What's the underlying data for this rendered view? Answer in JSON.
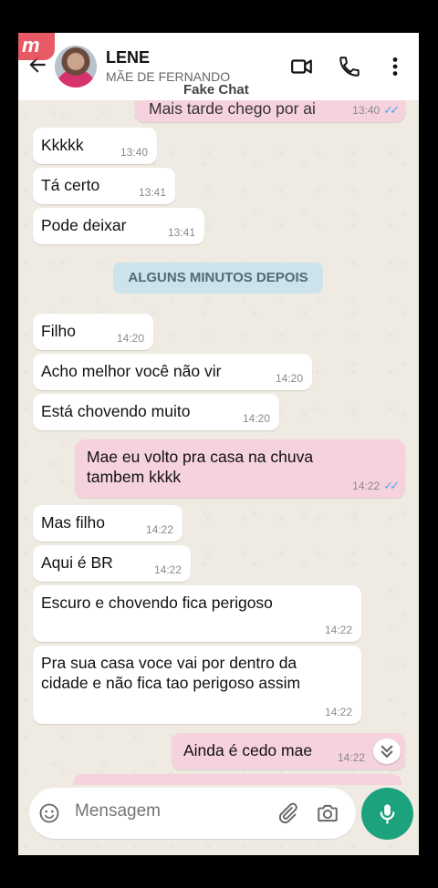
{
  "header": {
    "contact_name": "LENE",
    "contact_subtitle": "MÃE DE FERNANDO",
    "watermark": "Fake Chat",
    "logo_text": "m"
  },
  "messages": [
    {
      "dir": "out",
      "text": "Mais tarde chego por ai",
      "time": "13:40",
      "read": true
    },
    {
      "dir": "in",
      "text": "Kkkkk",
      "time": "13:40"
    },
    {
      "dir": "in",
      "text": "Tá certo",
      "time": "13:41"
    },
    {
      "dir": "in",
      "text": "Pode deixar",
      "time": "13:41"
    },
    {
      "dir": "in",
      "text": "Filho",
      "time": "14:20"
    },
    {
      "dir": "in",
      "text": "Acho melhor você não vir",
      "time": "14:20"
    },
    {
      "dir": "in",
      "text": "Está chovendo muito",
      "time": "14:20"
    },
    {
      "dir": "out",
      "text": "Mae eu volto pra casa na chuva tambem kkkk",
      "time": "14:22",
      "read": true
    },
    {
      "dir": "in",
      "text": "Mas filho",
      "time": "14:22"
    },
    {
      "dir": "in",
      "text": "Aqui é BR",
      "time": "14:22"
    },
    {
      "dir": "in",
      "text": "Escuro e chovendo fica perigoso",
      "time": "14:22"
    },
    {
      "dir": "in",
      "text": "Pra sua casa voce vai por dentro da cidade e não fica tao perigoso assim",
      "time": "14:22"
    },
    {
      "dir": "out",
      "text": "Ainda é cedo mae",
      "time": "14:22"
    }
  ],
  "date_divider": "ALGUNS MINUTOS DEPOIS",
  "composer": {
    "placeholder": "Mensagem"
  },
  "icons": {
    "back": "arrow-left-icon",
    "video": "video-call-icon",
    "phone": "phone-icon",
    "menu": "more-vert-icon",
    "emoji": "emoji-icon",
    "attach": "paperclip-icon",
    "camera": "camera-icon",
    "mic": "mic-icon",
    "scroll": "double-chevron-down-icon"
  },
  "colors": {
    "outgoing_bubble": "#f6d2dc",
    "incoming_bubble": "#ffffff",
    "accent": "#1da27e",
    "read_ticks": "#4fa6e8"
  }
}
